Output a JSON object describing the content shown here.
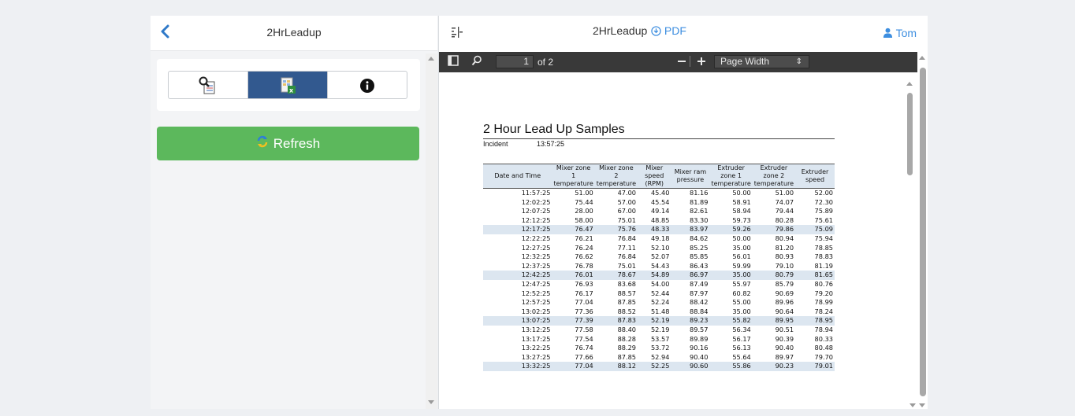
{
  "left": {
    "back_label": "‹",
    "title": "2HrLeadup",
    "tabs": [
      {
        "name": "search-report-icon",
        "active": false
      },
      {
        "name": "excel-report-icon",
        "active": true
      },
      {
        "name": "info-icon",
        "active": false
      }
    ],
    "refresh_label": "Refresh"
  },
  "right": {
    "title": "2HrLeadup",
    "pdf_label": "PDF",
    "user_name": "Tom"
  },
  "pdf_toolbar": {
    "page": "1",
    "of_label": "of 2",
    "zoom_value": "Page Width"
  },
  "doc": {
    "title": "2 Hour Lead Up Samples",
    "incident_label": "Incident",
    "incident_time": "13:57:25",
    "columns": [
      "Date and Time",
      "Mixer zone 1 temperature",
      "Mixer zone 2 temperature",
      "Mixer speed (RPM)",
      "Mixer ram pressure",
      "Extruder zone 1 temperature",
      "Extruder zone 2 temperature",
      "Extruder speed"
    ],
    "rows": [
      [
        "11:57:25",
        "51.00",
        "47.00",
        "45.40",
        "81.16",
        "50.00",
        "51.00",
        "52.00"
      ],
      [
        "12:02:25",
        "75.44",
        "57.00",
        "45.54",
        "81.89",
        "58.91",
        "74.07",
        "72.30"
      ],
      [
        "12:07:25",
        "28.00",
        "67.00",
        "49.14",
        "82.61",
        "58.94",
        "79.44",
        "75.89"
      ],
      [
        "12:12:25",
        "58.00",
        "75.01",
        "48.85",
        "83.30",
        "59.73",
        "80.28",
        "75.61"
      ],
      [
        "12:17:25",
        "76.47",
        "75.76",
        "48.33",
        "83.97",
        "59.26",
        "79.86",
        "75.09"
      ],
      [
        "12:22:25",
        "76.21",
        "76.84",
        "49.18",
        "84.62",
        "50.00",
        "80.94",
        "75.94"
      ],
      [
        "12:27:25",
        "76.24",
        "77.11",
        "52.10",
        "85.25",
        "35.00",
        "81.20",
        "78.85"
      ],
      [
        "12:32:25",
        "76.62",
        "76.84",
        "52.07",
        "85.85",
        "56.01",
        "80.93",
        "78.83"
      ],
      [
        "12:37:25",
        "76.78",
        "75.01",
        "54.43",
        "86.43",
        "59.99",
        "79.10",
        "81.19"
      ],
      [
        "12:42:25",
        "76.01",
        "78.67",
        "54.89",
        "86.97",
        "35.00",
        "80.79",
        "81.65"
      ],
      [
        "12:47:25",
        "76.93",
        "83.68",
        "54.00",
        "87.49",
        "55.97",
        "85.79",
        "80.76"
      ],
      [
        "12:52:25",
        "76.17",
        "88.57",
        "52.44",
        "87.97",
        "60.82",
        "90.69",
        "79.20"
      ],
      [
        "12:57:25",
        "77.04",
        "87.85",
        "52.24",
        "88.42",
        "55.00",
        "89.96",
        "78.99"
      ],
      [
        "13:02:25",
        "77.36",
        "88.52",
        "51.48",
        "88.84",
        "35.00",
        "90.64",
        "78.24"
      ],
      [
        "13:07:25",
        "77.39",
        "87.83",
        "52.19",
        "89.23",
        "55.82",
        "89.95",
        "78.95"
      ],
      [
        "13:12:25",
        "77.58",
        "88.40",
        "52.19",
        "89.57",
        "56.34",
        "90.51",
        "78.94"
      ],
      [
        "13:17:25",
        "77.54",
        "88.28",
        "53.57",
        "89.89",
        "56.17",
        "90.39",
        "80.33"
      ],
      [
        "13:22:25",
        "76.74",
        "88.29",
        "53.72",
        "90.16",
        "56.13",
        "90.40",
        "80.48"
      ],
      [
        "13:27:25",
        "77.66",
        "87.85",
        "52.94",
        "90.40",
        "55.64",
        "89.97",
        "79.70"
      ],
      [
        "13:32:25",
        "77.04",
        "88.12",
        "52.25",
        "90.60",
        "55.86",
        "90.23",
        "79.01"
      ]
    ],
    "highlight_rows": [
      4,
      9,
      14,
      19
    ]
  },
  "colors": {
    "accent_blue": "#2f79c8",
    "link_blue": "#3d8ee0",
    "active_tab": "#32598f",
    "refresh_green": "#5cb85c",
    "toolbar_dark": "#393939",
    "table_highlight": "#dce6f0"
  }
}
